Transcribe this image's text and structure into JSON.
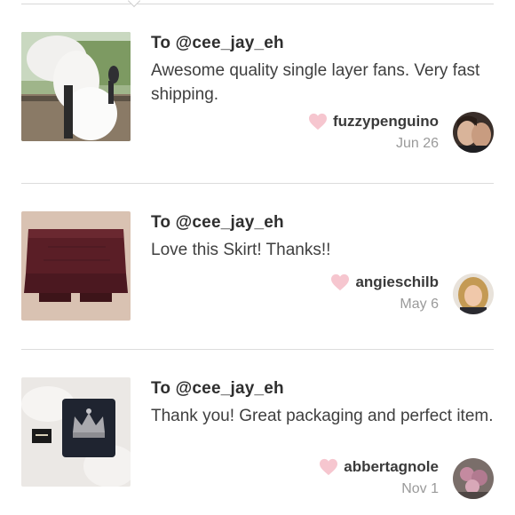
{
  "reviews": [
    {
      "to": "To @cee_jay_eh",
      "message": "Awesome quality single layer fans. Very fast shipping.",
      "username": "fuzzypenguino",
      "date": "Jun 26",
      "thumb_icon": "white-feather-fans-photo",
      "avatar_icon": "couple-avatar-photo"
    },
    {
      "to": "To @cee_jay_eh",
      "message": "Love this Skirt! Thanks!!",
      "username": "angieschilb",
      "date": "May 6",
      "thumb_icon": "burgundy-skirt-photo",
      "avatar_icon": "blonde-woman-avatar-photo"
    },
    {
      "to": "To @cee_jay_eh",
      "message": "Thank you! Great packaging and perfect item.",
      "username": "abbertagnole",
      "date": "Nov 1",
      "thumb_icon": "crown-wallet-photo",
      "avatar_icon": "flowers-avatar-photo"
    }
  ],
  "colors": {
    "heart": "#f6c6cf",
    "divider": "#dcdcdc",
    "date": "#9a9a9a"
  }
}
